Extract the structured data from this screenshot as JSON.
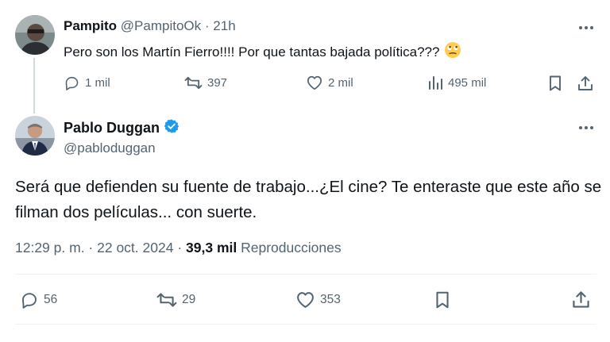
{
  "reply_tweet": {
    "author_name": "Pampito",
    "author_handle": "@PampitoOk",
    "separator": "·",
    "time_ago": "21h",
    "text": "Pero son los Martín Fierro!!!! Por que tantas bajada política???",
    "emoji": "🙄",
    "actions": {
      "replies": "1 mil",
      "reposts": "397",
      "likes": "2 mil",
      "views": "495 mil"
    }
  },
  "main_tweet": {
    "author_name": "Pablo Duggan",
    "author_handle": "@pabloduggan",
    "verified": true,
    "text": "Será que defienden su fuente de trabajo...¿El cine? Te enteraste que este año se filman dos películas... con suerte.",
    "time": "12:29 p. m.",
    "date_separator": " · ",
    "date": "22 oct. 2024",
    "views_count": "39,3 mil",
    "views_label": "Reproducciones",
    "actions": {
      "replies": "56",
      "reposts": "29",
      "likes": "353"
    }
  },
  "colors": {
    "text_primary": "#0f1419",
    "text_secondary": "#536471",
    "verified_blue": "#1d9bf0",
    "thread_line": "#cfd9de",
    "divider": "#eff3f4"
  },
  "icons": [
    "reply-icon",
    "repost-icon",
    "like-icon",
    "views-icon",
    "bookmark-icon",
    "share-icon",
    "more-icon",
    "verified-badge-icon"
  ]
}
